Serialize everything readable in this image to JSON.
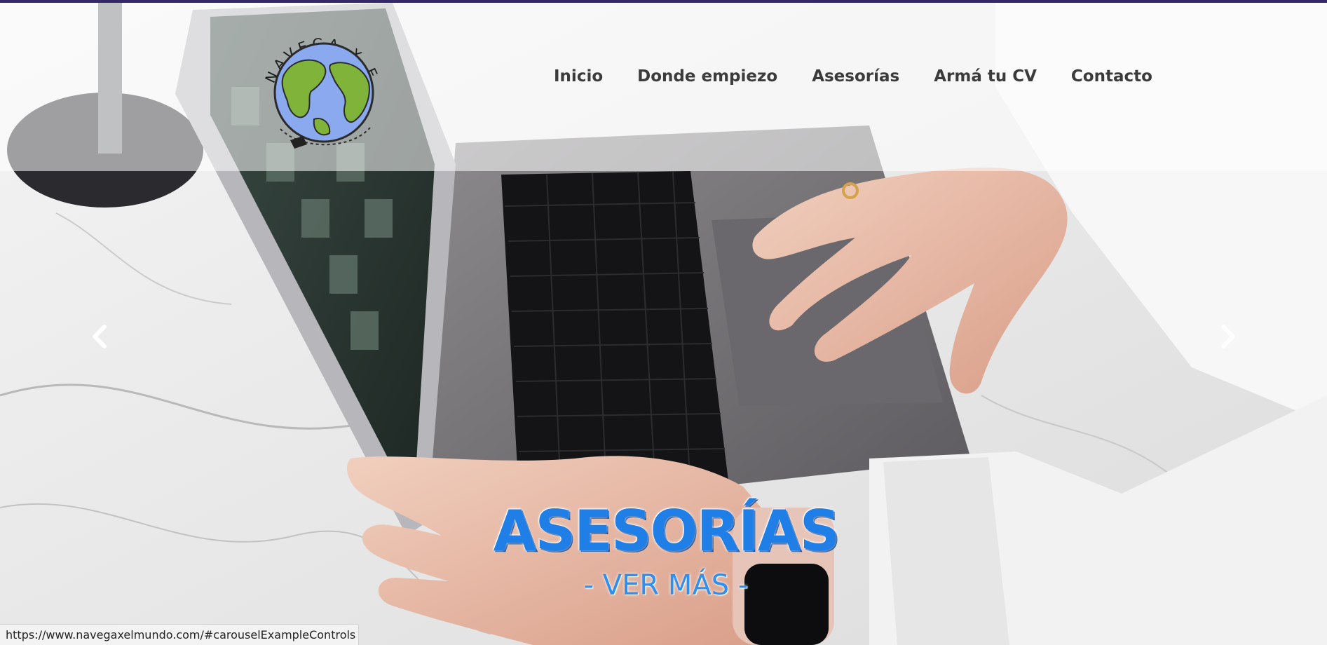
{
  "nav": {
    "items": [
      {
        "label": "Inicio"
      },
      {
        "label": "Donde empiezo"
      },
      {
        "label": "Asesorías"
      },
      {
        "label": "Armá tu CV"
      },
      {
        "label": "Contacto"
      }
    ]
  },
  "logo": {
    "text": "NAVEGA X EL MUNDO"
  },
  "carousel": {
    "caption_title": "ASESORÍAS",
    "caption_link": "- VER MÁS -",
    "prev_icon": "chevron-left",
    "next_icon": "chevron-right"
  },
  "status_bar": {
    "url": "https://www.navegaxelmundo.com/#carouselExampleControls"
  },
  "colors": {
    "accent_bar": "#34286b",
    "caption_blue": "#1f7fe6",
    "nav_text": "#3b3b3b"
  }
}
